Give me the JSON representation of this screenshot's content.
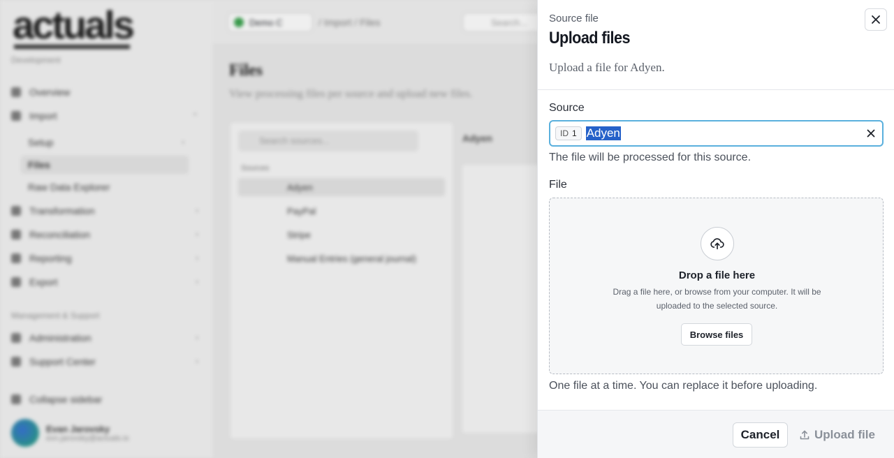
{
  "background": {
    "logo": "actuals",
    "environment": "Development",
    "nav": [
      {
        "label": "Overview"
      },
      {
        "label": "Import"
      },
      {
        "label": "Setup"
      },
      {
        "label": "Files"
      },
      {
        "label": "Raw Data Explorer"
      },
      {
        "label": "Transformation"
      },
      {
        "label": "Reconciliation"
      },
      {
        "label": "Reporting"
      },
      {
        "label": "Export"
      }
    ],
    "section_label": "Management & Support",
    "nav2": [
      {
        "label": "Administration"
      },
      {
        "label": "Support Center"
      },
      {
        "label": "Collapse sidebar"
      }
    ],
    "user": {
      "name": "Evan Jarovsky",
      "email": "evn.jarovsky@actuals.io"
    },
    "workspace": "Demo C",
    "breadcrumb": "/ Import / Files",
    "top_search": "Search...",
    "page_title": "Files",
    "page_subtitle": "View processing files per source and upload new files.",
    "source_search": "Search sources...",
    "sources_label": "Sources",
    "sources": [
      "Adyen",
      "PayPal",
      "Stripe",
      "Manual Entries (general journal)"
    ],
    "right_header": "Adyen"
  },
  "dialog": {
    "eyebrow": "Source file",
    "title": "Upload files",
    "description": "Upload a file for Adyen.",
    "source_label": "Source",
    "source_id_prefix": "ID",
    "source_id": "1",
    "source_value": "Adyen",
    "source_hint": "The file will be processed for this source.",
    "file_label": "File",
    "drop_title": "Drop a file here",
    "drop_desc": "Drag a file here, or browse from your computer. It will be uploaded to the selected source.",
    "browse_label": "Browse files",
    "file_hint": "One file at a time. You can replace it before uploading.",
    "cancel_label": "Cancel",
    "upload_label": "Upload file"
  },
  "colors": {
    "focus_ring": "#5ab0dd",
    "selection": "#2561c9",
    "disabled_text": "#8a9099"
  }
}
